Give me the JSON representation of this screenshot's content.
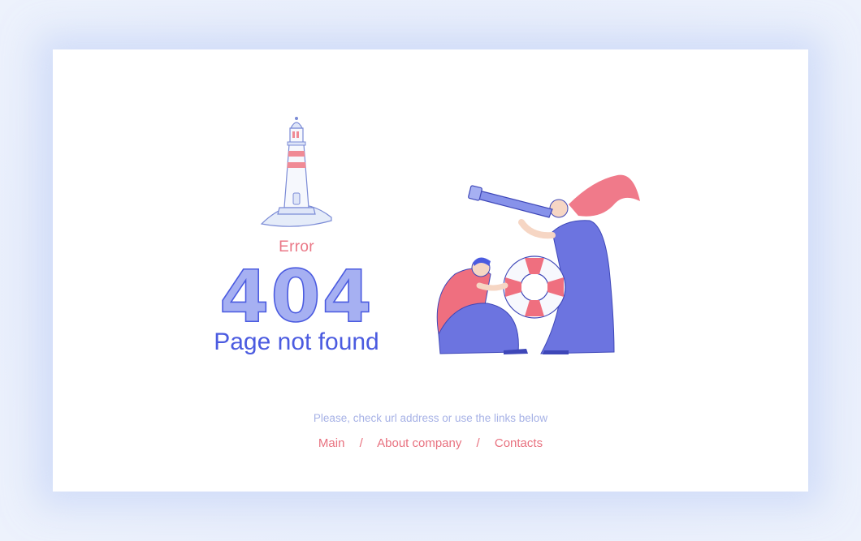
{
  "error": {
    "label": "Error",
    "code": "404",
    "title": "Page not found"
  },
  "hint": "Please, check url address or use the links below",
  "links": {
    "items": [
      {
        "label": "Main"
      },
      {
        "label": "About company"
      },
      {
        "label": "Contacts"
      }
    ],
    "separator": "/"
  },
  "colors": {
    "accent_blue": "#4b5be0",
    "soft_blue": "#a6b0f2",
    "accent_red": "#e8717f",
    "hint": "#a7b2e6",
    "background": "#e9effb",
    "card": "#ffffff"
  },
  "icons": [
    "lighthouse-icon",
    "people-lifebuoy-illustration"
  ]
}
